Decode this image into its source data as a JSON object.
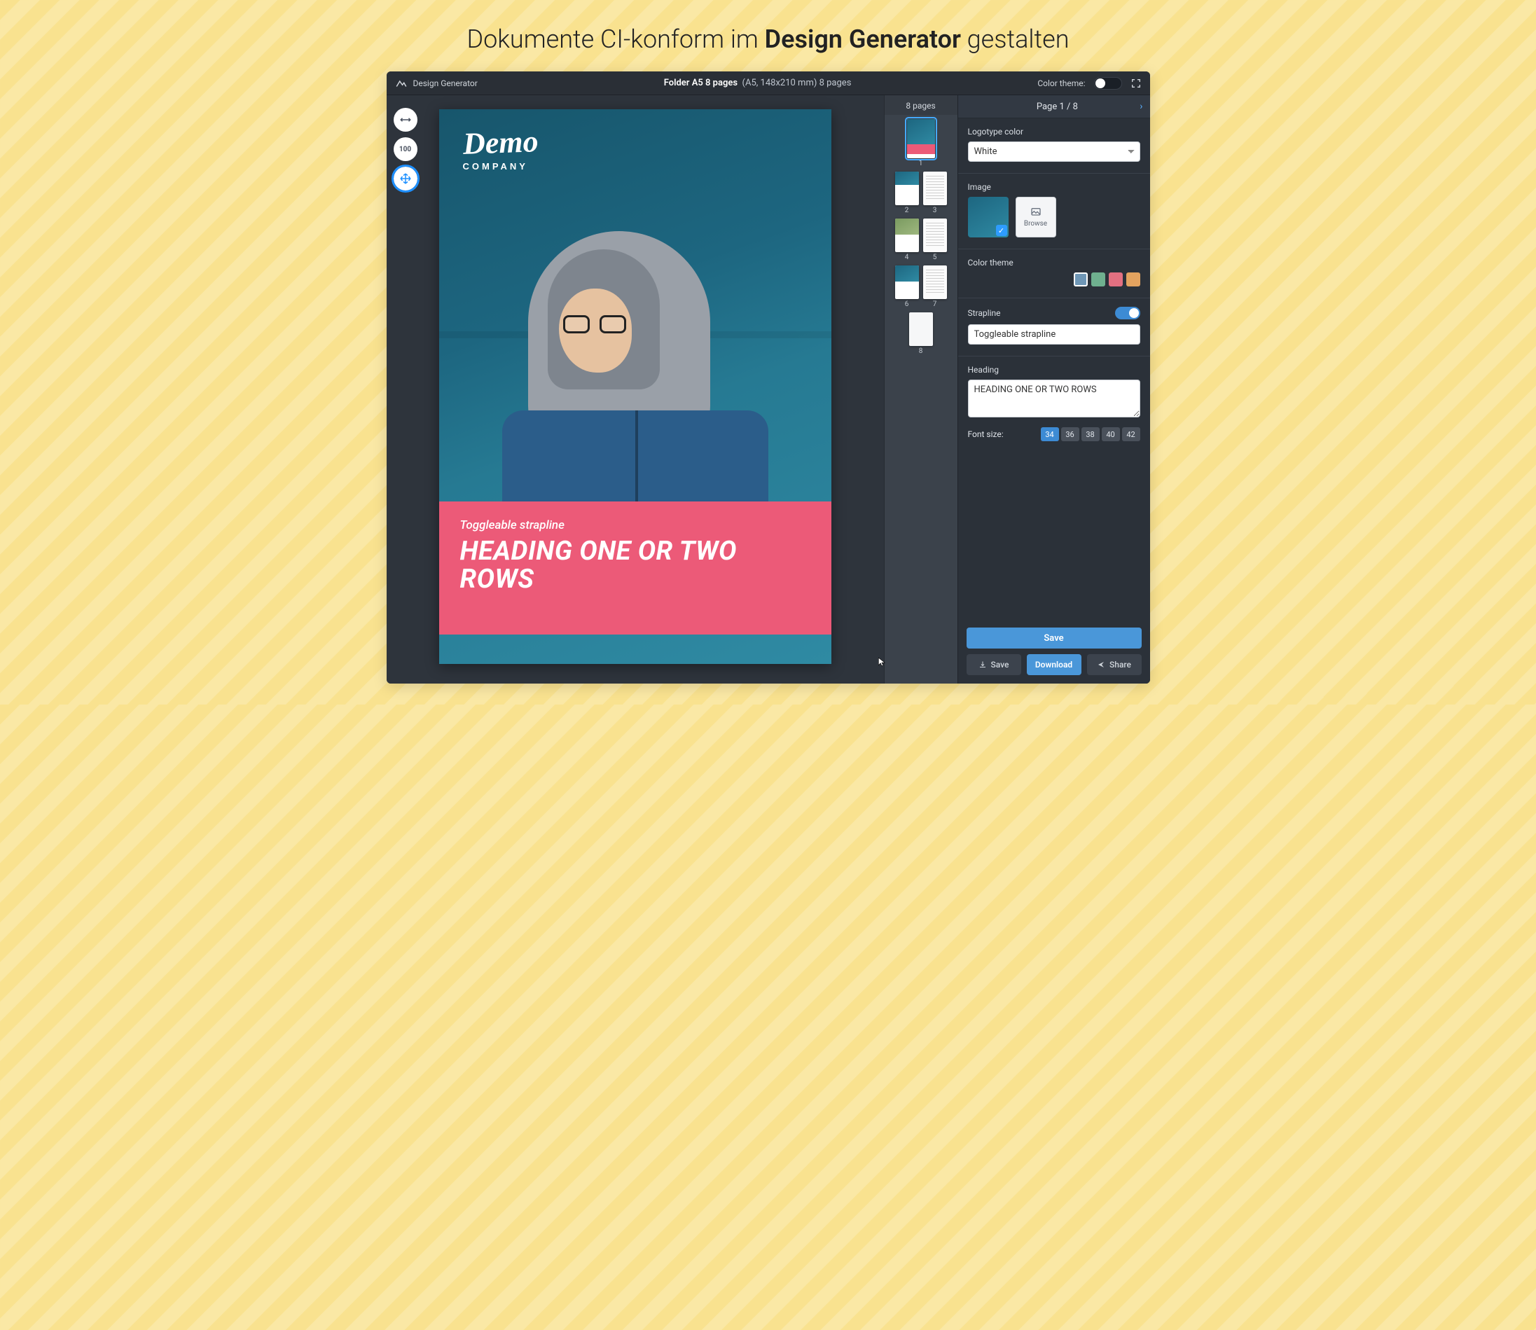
{
  "pageTitle": {
    "pre": "Dokumente CI-konform im ",
    "strong": "Design Generator",
    "post": " gestalten"
  },
  "brand": "Design Generator",
  "topbar": {
    "docName": "Folder A5 8 pages",
    "meta": "(A5, 148x210 mm) 8 pages",
    "colorThemeLabel": "Color theme:"
  },
  "canvas": {
    "logoScript": "Demo",
    "logoSub": "COMPANY",
    "strapline": "Toggleable strapline",
    "heading": "HEADING ONE OR TWO ROWS"
  },
  "pagesCol": {
    "title": "8 pages",
    "labels": [
      "1",
      "2",
      "3",
      "4",
      "5",
      "6",
      "7",
      "8"
    ]
  },
  "props": {
    "header": "Page 1 / 8",
    "logotypeColorLabel": "Logotype color",
    "logotypeColorValue": "White",
    "imageLabel": "Image",
    "browseLabel": "Browse",
    "colorThemeLabel": "Color theme",
    "swatches": [
      "#6f97b6",
      "#6fb08f",
      "#e37081",
      "#e3a35f"
    ],
    "straplineLabel": "Strapline",
    "straplineValue": "Toggleable strapline",
    "headingLabel": "Heading",
    "headingValue": "HEADING ONE OR TWO ROWS",
    "fontSizeLabel": "Font size:",
    "fontSizes": [
      "34",
      "36",
      "38",
      "40",
      "42"
    ],
    "fontSizeActive": "34"
  },
  "footer": {
    "savePrimary": "Save",
    "saveSec": "Save",
    "download": "Download",
    "share": "Share"
  }
}
